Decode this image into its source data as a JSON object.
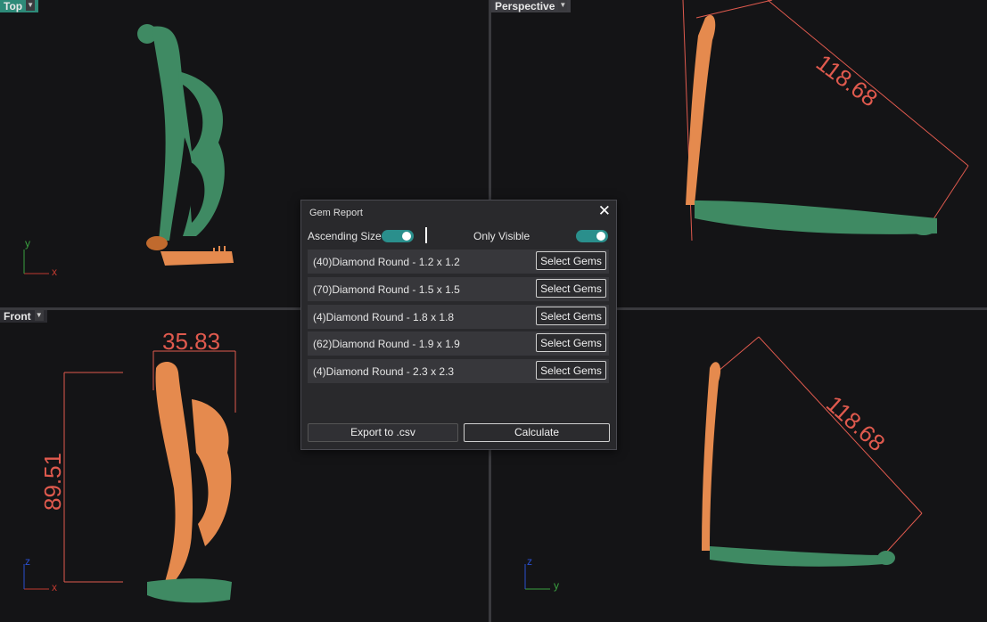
{
  "viewports": {
    "top": {
      "label": "Top"
    },
    "perspective": {
      "label": "Perspective",
      "dimension": "118.68"
    },
    "front": {
      "label": "Front",
      "dim_width": "35.83",
      "dim_height": "89.51"
    },
    "right": {
      "dimension": "118.68"
    }
  },
  "axes": {
    "x": "x",
    "y": "y",
    "z": "z"
  },
  "dialog": {
    "title": "Gem Report",
    "ascending_label": "Ascending Size",
    "ascending_on": true,
    "only_visible_label": "Only Visible",
    "only_visible_on": true,
    "rows": [
      {
        "name": "(40)Diamond Round - 1.2 x 1.2",
        "button": "Select Gems"
      },
      {
        "name": "(70)Diamond Round - 1.5 x 1.5",
        "button": "Select Gems"
      },
      {
        "name": "(4)Diamond Round - 1.8 x 1.8",
        "button": "Select Gems"
      },
      {
        "name": "(62)Diamond Round - 1.9 x 1.9",
        "button": "Select Gems"
      },
      {
        "name": "(4)Diamond Round - 2.3 x 2.3",
        "button": "Select Gems"
      }
    ],
    "export_label": "Export to .csv",
    "calculate_label": "Calculate"
  },
  "colors": {
    "green_model": "#3f8a63",
    "orange_model": "#e58a4e",
    "dimension_red": "#e05a4e",
    "toggle_accent": "#2a8f8c"
  }
}
